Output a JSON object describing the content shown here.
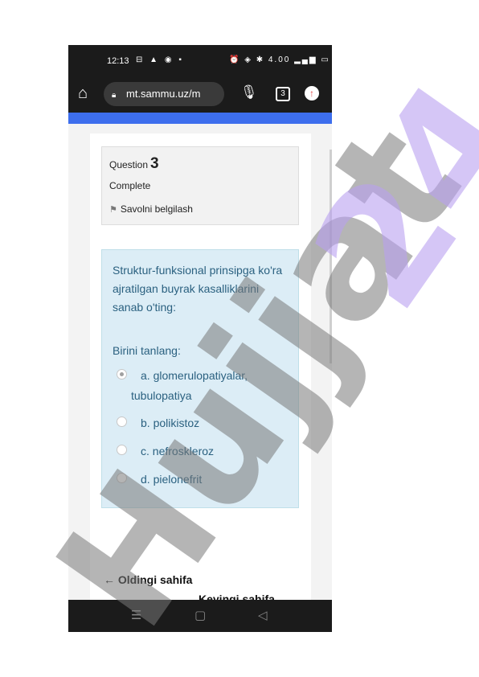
{
  "status_bar": {
    "time": "12:13",
    "left_icons": "⊟ ▲ ◉ ▪",
    "right_icons": "⏰ ◈ ✱ 4.00 ▂▄▆ ▭"
  },
  "browser": {
    "url": "mt.sammu.uz/m",
    "tab_count": "3"
  },
  "question": {
    "label": "Question",
    "number": "3",
    "state": "Complete",
    "flag_label": "Savolni belgilash",
    "text": "Struktur-funksional prinsipga ko'ra ajratilgan buyrak kasalliklarini sanab o'ting:",
    "prompt": "Birini tanlang:",
    "options": [
      {
        "label": "a. glomerulopatiyalar,",
        "cont": "tubulopatiya",
        "selected": true
      },
      {
        "label": "b. polikistoz",
        "selected": false
      },
      {
        "label": "c. nefroskleroz",
        "selected": false
      },
      {
        "label": "d. pielonefrit",
        "selected": false
      }
    ]
  },
  "navigation": {
    "prev": "← Oldingi sahifa",
    "next": "Keyingi sahifa"
  },
  "watermark": {
    "text": "Hujjat",
    "number": "24"
  },
  "colors": {
    "accent_blue": "#3d6eed",
    "question_bg": "#dcedf6",
    "question_text": "#2b6180"
  }
}
